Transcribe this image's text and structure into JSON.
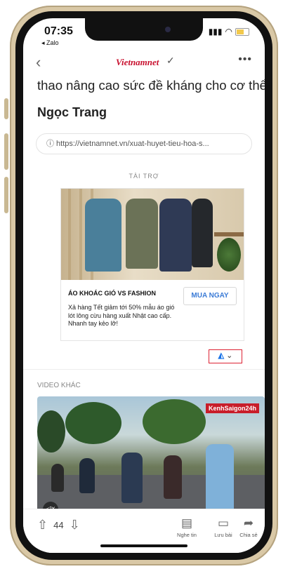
{
  "status_bar": {
    "time": "07:35",
    "back_app": "◂ Zalo",
    "signal_icon": "signal-icon",
    "wifi_icon": "wifi-icon"
  },
  "nav": {
    "brand": "Vietnamnet",
    "back_icon": "back-chevron-icon",
    "verified_icon": "checkmark-icon",
    "more_icon": "more-dots-icon"
  },
  "article": {
    "body_tail": "thao nâng cao sức đề kháng cho cơ thể.",
    "author": "Ngọc Trang",
    "source_url": "ⓘ https://vietnamnet.vn/xuat-huyet-tieu-hoa-s..."
  },
  "ad": {
    "label": "TÀI TRỢ",
    "title": "ÁO KHOÁC GIÓ VS FASHION",
    "cta": "MUA NGAY",
    "description": "Xả hàng Tết giảm tới 50% mẫu áo gió lót lông cừu hàng xuất Nhật cao cấp. Nhanh tay kẻo lỡ!",
    "adchoices_icon": "adchoices-icon"
  },
  "video": {
    "section_label": "VIDEO KHÁC",
    "logo_text": "KenhSaigon24h"
  },
  "bottom_bar": {
    "vote_count": "44",
    "listen_label": "Nghe tin",
    "save_label": "Lưu bài",
    "share_label": "Chia sẻ"
  },
  "colors": {
    "brand_red": "#c8102e",
    "cta_blue": "#3b7bd6",
    "highlight_red": "#dd2233"
  }
}
